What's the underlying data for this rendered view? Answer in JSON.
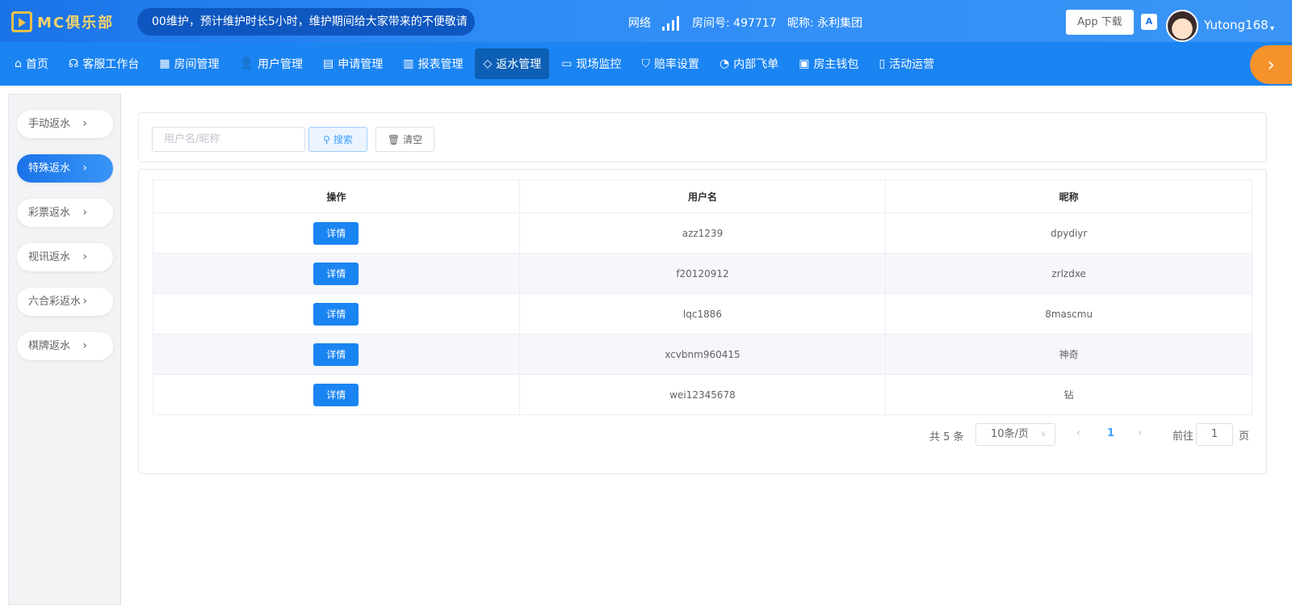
{
  "header": {
    "logo_text": "MC俱乐部",
    "notice": "00维护，预计维护时长5小时，维护期间给大家带来的不便敬请",
    "network_label": "网络",
    "room": "房间号: 497717",
    "nickname": "昵称: 永利集团",
    "app_download": "App 下载",
    "translate_icon_text": "A",
    "username": "Yutong168",
    "caret": "▾"
  },
  "nav": {
    "items": [
      {
        "label": "首页",
        "icon": "⌂"
      },
      {
        "label": "客服工作台",
        "icon": "☊"
      },
      {
        "label": "房间管理",
        "icon": "▦"
      },
      {
        "label": "用户管理",
        "icon": "👤"
      },
      {
        "label": "申请管理",
        "icon": "▤"
      },
      {
        "label": "报表管理",
        "icon": "▥"
      },
      {
        "label": "返水管理",
        "icon": "◇"
      },
      {
        "label": "现场监控",
        "icon": "▭"
      },
      {
        "label": "赔率设置",
        "icon": "⛉"
      },
      {
        "label": "内部飞单",
        "icon": "◔"
      },
      {
        "label": "房主钱包",
        "icon": "▣"
      },
      {
        "label": "活动运营",
        "icon": "▯"
      }
    ],
    "active_index": 6,
    "expand_arrow": "›"
  },
  "sidebar": {
    "items": [
      {
        "label": "手动返水"
      },
      {
        "label": "特殊返水"
      },
      {
        "label": "彩票返水"
      },
      {
        "label": "视讯返水"
      },
      {
        "label": "六合彩返水"
      },
      {
        "label": "棋牌返水"
      }
    ],
    "active_index": 1
  },
  "search": {
    "placeholder": "用户名/昵称",
    "search_label": "搜索",
    "clear_label": "清空"
  },
  "table": {
    "columns": [
      "操作",
      "用户名",
      "昵称"
    ],
    "detail_label": "详情",
    "rows": [
      {
        "username": "azz1239",
        "nickname": "dpydiyr"
      },
      {
        "username": "f20120912",
        "nickname": "zrlzdxe"
      },
      {
        "username": "lqc1886",
        "nickname": "8mascmu"
      },
      {
        "username": "xcvbnm960415",
        "nickname": "神奇"
      },
      {
        "username": "wei12345678",
        "nickname": "钻"
      }
    ]
  },
  "pagination": {
    "total": "共 5 条",
    "page_size": "10条/页",
    "current_page": "1",
    "goto_label": "前往",
    "goto_value": "1",
    "goto_suffix": "页"
  },
  "colors": {
    "primary": "#1a84f2",
    "accent_orange": "#f6922b",
    "logo_gold": "#f3c04a"
  }
}
